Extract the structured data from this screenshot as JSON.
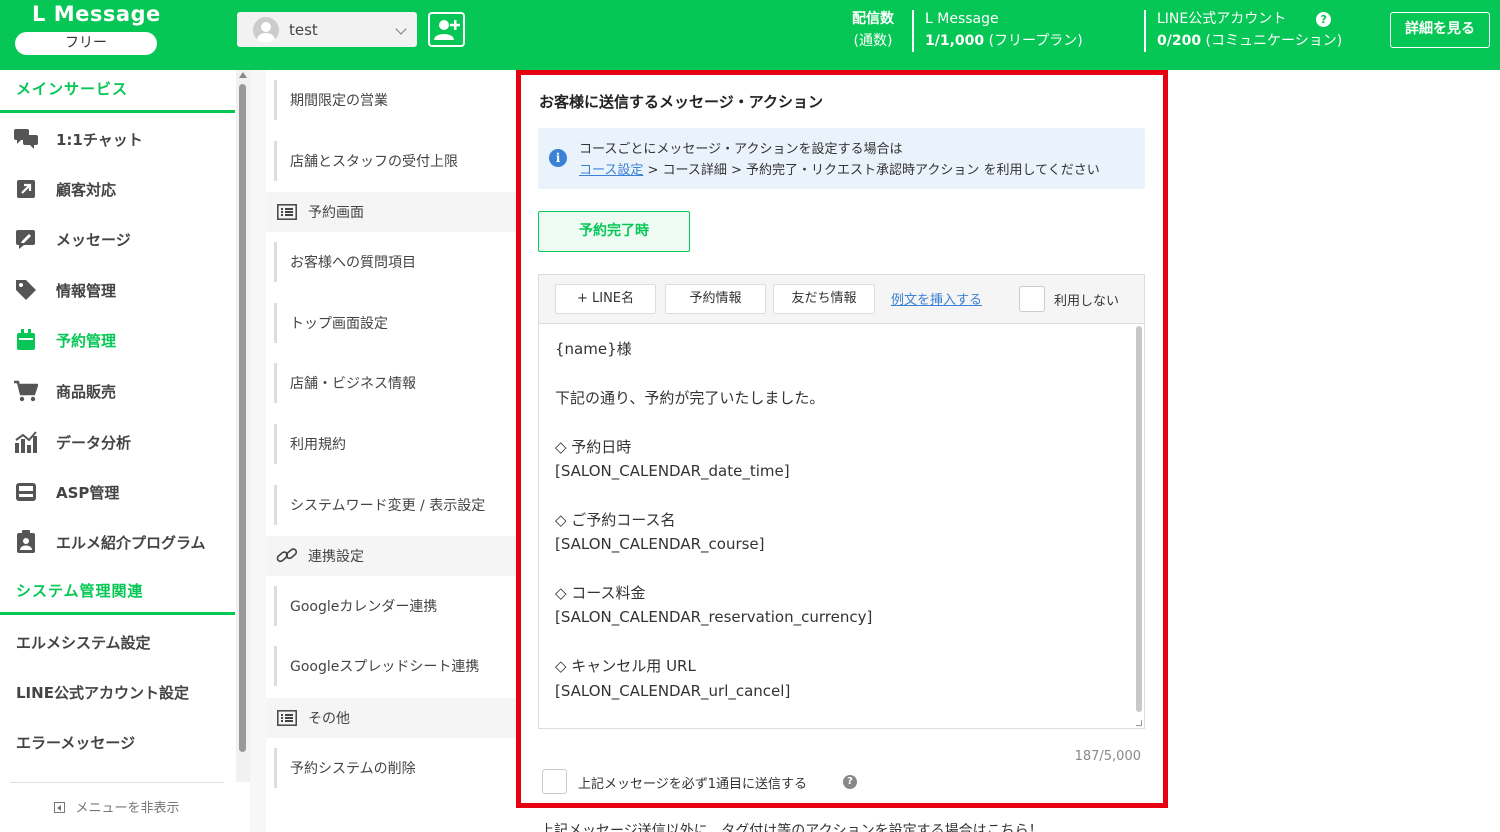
{
  "header": {
    "logo": "L Message",
    "plan": "フリー",
    "account_name": "test",
    "delivery_label_1": "配信数",
    "delivery_label_2": "(通数)",
    "lm_title": "L Message",
    "lm_count": "1/1,000",
    "lm_plan": "(フリープラン)",
    "line_title": "LINE公式アカウント",
    "line_count": "0/200",
    "line_plan": "(コミュニケーション)",
    "help_glyph": "?",
    "detail_button": "詳細を見る",
    "brand_color": "#06c755"
  },
  "sidebar": {
    "main_title": "メインサービス",
    "items": [
      {
        "label": "1:1チャット",
        "icon": "chat-icon"
      },
      {
        "label": "顧客対応",
        "icon": "arrow-box-icon"
      },
      {
        "label": "メッセージ",
        "icon": "message-edit-icon"
      },
      {
        "label": "情報管理",
        "icon": "tag-icon"
      },
      {
        "label": "予約管理",
        "icon": "calendar-icon"
      },
      {
        "label": "商品販売",
        "icon": "cart-icon"
      },
      {
        "label": "データ分析",
        "icon": "bar-chart-icon"
      },
      {
        "label": "ASP管理",
        "icon": "register-icon"
      },
      {
        "label": "エルメ紹介プログラム",
        "icon": "clipboard-icon"
      }
    ],
    "system_title": "システム管理関連",
    "system_items": [
      "エルメシステム設定",
      "LINE公式アカウント設定",
      "エラーメッセージ"
    ],
    "hide_menu": "メニューを非表示"
  },
  "submenu": {
    "items": [
      {
        "type": "item",
        "label": "期間限定の営業"
      },
      {
        "type": "item",
        "label": "店舗とスタッフの受付上限"
      },
      {
        "type": "category",
        "label": "予約画面",
        "icon": "list-icon"
      },
      {
        "type": "item",
        "label": "お客様への質問項目"
      },
      {
        "type": "item",
        "label": "トップ画面設定"
      },
      {
        "type": "item",
        "label": "店舗・ビジネス情報"
      },
      {
        "type": "item",
        "label": "利用規約"
      },
      {
        "type": "item",
        "label": "システムワード変更 / 表示設定"
      },
      {
        "type": "category",
        "label": "連携設定",
        "icon": "link-icon"
      },
      {
        "type": "item",
        "label": "Googleカレンダー連携"
      },
      {
        "type": "item",
        "label": "Googleスプレッドシート連携"
      },
      {
        "type": "category",
        "label": "その他",
        "icon": "list-icon"
      },
      {
        "type": "item",
        "label": "予約システムの削除"
      }
    ]
  },
  "panel": {
    "title": "お客様に送信するメッセージ・アクション",
    "info_line1": "コースごとにメッセージ・アクションを設定する場合は",
    "info_link": "コース設定",
    "info_line2_rest": " > コース詳細 > 予約完了・リクエスト承認時アクション を利用してください",
    "info_icon_glyph": "i",
    "tab_label": "予約完了時",
    "toolbar": {
      "line_name": "+ LINE名",
      "reserve_info": "予約情報",
      "friend_info": "友だち情報",
      "insert_example": "例文を挿入する",
      "not_use": "利用しない"
    },
    "message": "{name}様\n\n下記の通り、予約が完了いたしました。\n\n◇ 予約日時\n[SALON_CALENDAR_date_time]\n\n◇ ご予約コース名\n[SALON_CALENDAR_course]\n\n◇ コース料金\n[SALON_CALENDAR_reservation_currency]\n\n◇ キャンセル用 URL\n[SALON_CALENDAR_url_cancel]",
    "counter": "187/5,000",
    "force_first": "上記メッセージを必ず1通目に送信する",
    "q_glyph": "?",
    "highlight_color": "#e60012"
  },
  "bottom_note": "上記メッセージ送信以外に、タグ付け等のアクションを設定する場合はこちら！"
}
